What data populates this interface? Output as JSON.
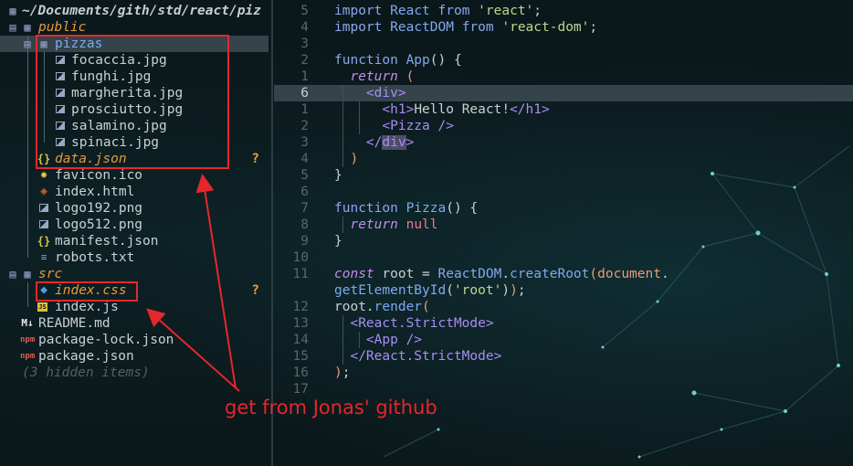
{
  "tree": {
    "root_path": "~/Documents/gith/std/react/piz",
    "items": [
      {
        "label": "public"
      },
      {
        "label": "pizzas"
      },
      {
        "label": "focaccia.jpg"
      },
      {
        "label": "funghi.jpg"
      },
      {
        "label": "margherita.jpg"
      },
      {
        "label": "prosciutto.jpg"
      },
      {
        "label": "salamino.jpg"
      },
      {
        "label": "spinaci.jpg"
      },
      {
        "label": "data.json",
        "git": "?"
      },
      {
        "label": "favicon.ico"
      },
      {
        "label": "index.html"
      },
      {
        "label": "logo192.png"
      },
      {
        "label": "logo512.png"
      },
      {
        "label": "manifest.json"
      },
      {
        "label": "robots.txt"
      },
      {
        "label": "src"
      },
      {
        "label": "index.css",
        "git": "?"
      },
      {
        "label": "index.js"
      },
      {
        "label": "README.md"
      },
      {
        "label": "package-lock.json"
      },
      {
        "label": "package.json"
      }
    ],
    "hidden_items": "(3 hidden items)"
  },
  "editor": {
    "line_numbers": [
      "5",
      "4",
      "3",
      "2",
      "1",
      "6",
      "1",
      "2",
      "3",
      "4",
      "5",
      "6",
      "7",
      "8",
      "9",
      "10",
      "11",
      "",
      "12",
      "13",
      "14",
      "15",
      "16",
      "17"
    ],
    "current_line_index": 5,
    "tokens": {
      "import": "import",
      "from": "from",
      "react_id": "React",
      "react_str": "'react'",
      "reactdom_id": "ReactDOM",
      "reactdom_str": "'react-dom'",
      "function_kw": "function",
      "app_fn": "App",
      "return_kw": "return",
      "open_div": "<div>",
      "h1_open": "<h1>",
      "hello": "Hello React!",
      "h1_close": "</h1>",
      "pizza_tag": "<Pizza />",
      "close_div_a": "</",
      "close_div_b": "div",
      "close_div_c": ">",
      "pizza_fn": "Pizza",
      "null_kw": "null",
      "const_kw": "const",
      "root_id": "root",
      "create_root": "createRoot",
      "document": "document",
      "get_by_id": "getElementById",
      "root_str": "'root'",
      "render": "render",
      "strict_open": "<React.StrictMode>",
      "app_tag": "<App />",
      "strict_close": "</React.StrictMode>"
    }
  },
  "annotation": {
    "text": "get from Jonas' github",
    "color": "#e5272c"
  }
}
